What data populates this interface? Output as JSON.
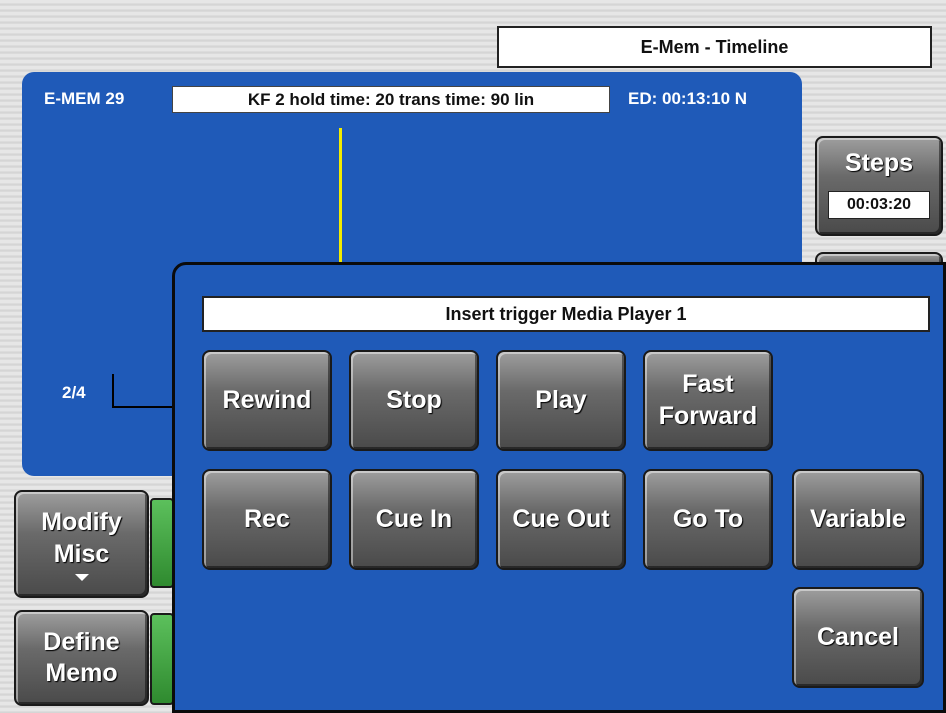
{
  "header": {
    "title": "E-Mem - Timeline"
  },
  "timeline": {
    "emem_label": "E-MEM 29",
    "kf_info": "KF 2 hold time: 20 trans time: 90 lin",
    "ed_label": "ED: 00:13:10 N",
    "page_indicator": "2/4"
  },
  "right_panel": {
    "steps_label": "Steps",
    "steps_value": "00:03:20"
  },
  "left_panel": {
    "modify_line1": "Modify",
    "modify_line2": "Misc",
    "define_line1": "Define",
    "define_line2": "Memo"
  },
  "dialog": {
    "title": "Insert trigger Media Player 1",
    "buttons": {
      "rewind": "Rewind",
      "stop": "Stop",
      "play": "Play",
      "fast_forward_1": "Fast",
      "fast_forward_2": "Forward",
      "rec": "Rec",
      "cue_in": "Cue In",
      "cue_out": "Cue Out",
      "go_to": "Go To",
      "variable": "Variable",
      "cancel": "Cancel"
    }
  },
  "colors": {
    "panel_blue": "#1f5ab8",
    "playhead_yellow": "#f2ec00",
    "tab_green": "#2f8a2f"
  }
}
